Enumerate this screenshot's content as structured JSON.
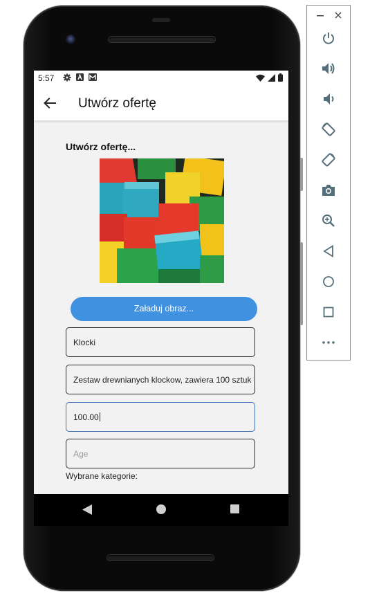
{
  "status_bar": {
    "time": "5:57",
    "left_icons": [
      "settings-icon",
      "a-notification-icon",
      "gmail-icon"
    ],
    "right_icons": [
      "wifi-icon",
      "signal-icon",
      "battery-icon"
    ]
  },
  "app_bar": {
    "title": "Utwórz ofertę"
  },
  "form": {
    "heading": "Utwórz ofertę...",
    "image_alt": "colorful-wooden-blocks",
    "load_button": "Załaduj obraz...",
    "title_value": "Klocki",
    "description_value": "Zestaw drewnianych klockow, zawiera 100 sztuk",
    "price_value": "100.00",
    "age_placeholder": "Age",
    "categories_label": "Wybrane kategorie:"
  },
  "nav_bar": {
    "buttons": [
      "back-nav",
      "home-nav",
      "recents-nav"
    ]
  },
  "emulator_toolbar": {
    "window_buttons": [
      "minimize",
      "close"
    ],
    "tools": [
      "power",
      "volume-up",
      "volume-down",
      "rotate-left",
      "rotate-right",
      "screenshot",
      "zoom",
      "back",
      "home",
      "overview",
      "more"
    ]
  },
  "colors": {
    "accent": "#4191e1",
    "focus_border": "#3b6fb6",
    "screen_bg": "#f2f2f2"
  }
}
